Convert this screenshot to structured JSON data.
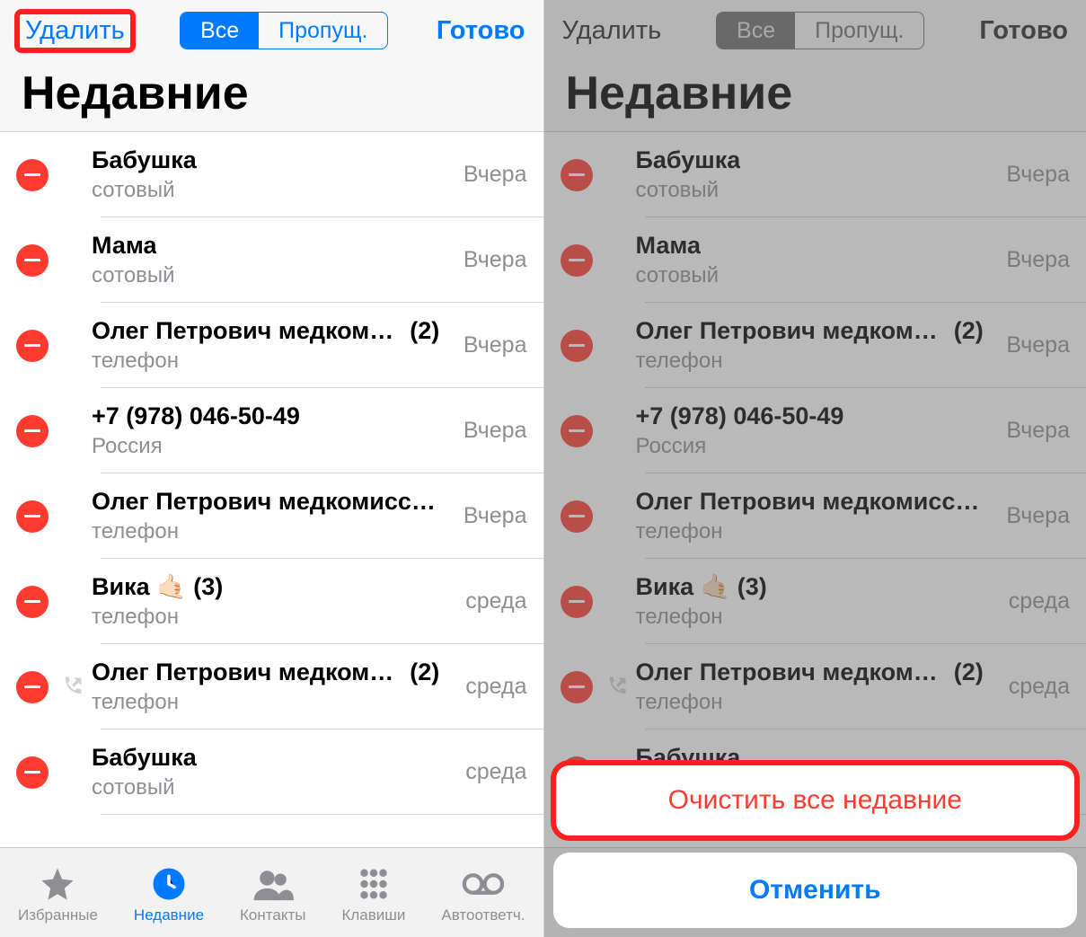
{
  "left": {
    "topbar": {
      "delete": "Удалить",
      "seg_all": "Все",
      "seg_missed": "Пропущ.",
      "done": "Готово"
    },
    "title": "Недавние",
    "tabs": {
      "fav": "Избранные",
      "recents": "Недавние",
      "contacts": "Контакты",
      "keypad": "Клавиши",
      "voicemail": "Автоответч."
    }
  },
  "right": {
    "topbar": {
      "delete": "Удалить",
      "seg_all": "Все",
      "seg_missed": "Пропущ.",
      "done": "Готово"
    },
    "title": "Недавние",
    "tabs": {
      "fav": "Избранные",
      "recents": "Недавние",
      "contacts": "Контакты",
      "keypad": "Клавиши",
      "voicemail": "Автоответч."
    },
    "sheet": {
      "clear": "Очистить все недавние",
      "cancel": "Отменить"
    }
  },
  "calls": [
    {
      "name": "Бабушка",
      "sub": "сотовый",
      "time": "Вчера",
      "count": "",
      "outgoing": false
    },
    {
      "name": "Мама",
      "sub": "сотовый",
      "time": "Вчера",
      "count": "",
      "outgoing": false
    },
    {
      "name": "Олег Петрович медком…",
      "sub": "телефон",
      "time": "Вчера",
      "count": "(2)",
      "outgoing": false
    },
    {
      "name": "+7 (978) 046-50-49",
      "sub": "Россия",
      "time": "Вчера",
      "count": "",
      "outgoing": false
    },
    {
      "name": "Олег Петрович медкомисс…",
      "sub": "телефон",
      "time": "Вчера",
      "count": "",
      "outgoing": false
    },
    {
      "name": "Вика 🤙🏻 (3)",
      "sub": "телефон",
      "time": "среда",
      "count": "",
      "outgoing": false
    },
    {
      "name": "Олег Петрович медком…",
      "sub": "телефон",
      "time": "среда",
      "count": "(2)",
      "outgoing": true
    },
    {
      "name": "Бабушка",
      "sub": "сотовый",
      "time": "среда",
      "count": "",
      "outgoing": false
    }
  ]
}
